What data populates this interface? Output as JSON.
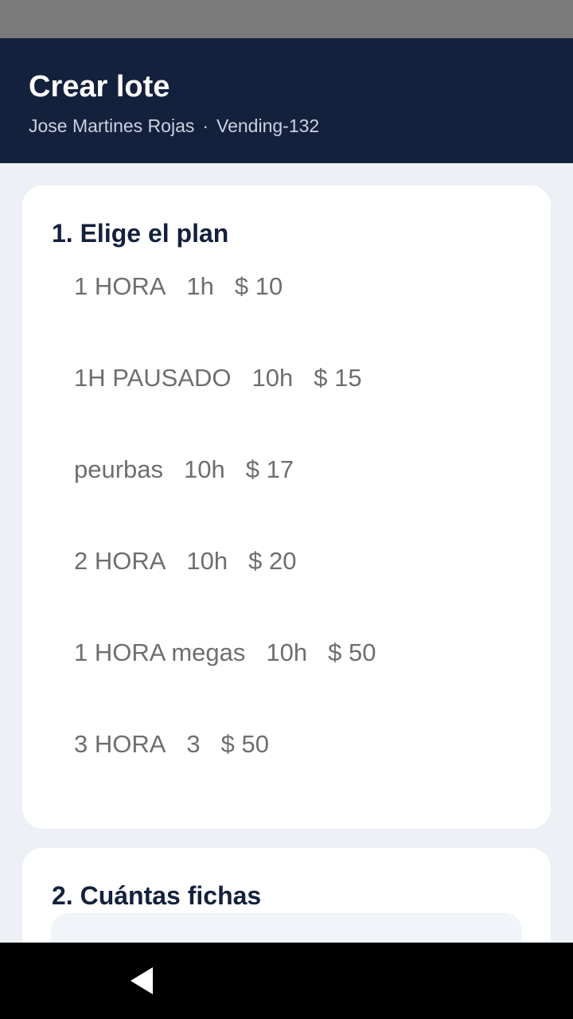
{
  "header": {
    "title": "Crear lote",
    "user": "Jose Martines Rojas",
    "separator": "·",
    "machine": "Vending-132"
  },
  "plans_section": {
    "heading": "1. Elige el plan",
    "plans": [
      {
        "name": "1 HORA",
        "duration": "1h",
        "price": "$ 10"
      },
      {
        "name": "1H PAUSADO",
        "duration": "10h",
        "price": "$ 15"
      },
      {
        "name": "peurbas",
        "duration": "10h",
        "price": "$ 17"
      },
      {
        "name": "2 HORA",
        "duration": "10h",
        "price": "$ 20"
      },
      {
        "name": "1 HORA megas",
        "duration": "10h",
        "price": "$ 50"
      },
      {
        "name": "3 HORA",
        "duration": "3",
        "price": "$ 50"
      }
    ]
  },
  "count_section": {
    "heading": "2. Cuántas fichas"
  },
  "nav": {
    "back_icon": "back-triangle-icon"
  },
  "colors": {
    "header_bg": "#14213d",
    "page_bg": "#edf1f5",
    "heading_text": "#14213d",
    "plan_text": "#6e6e72"
  }
}
